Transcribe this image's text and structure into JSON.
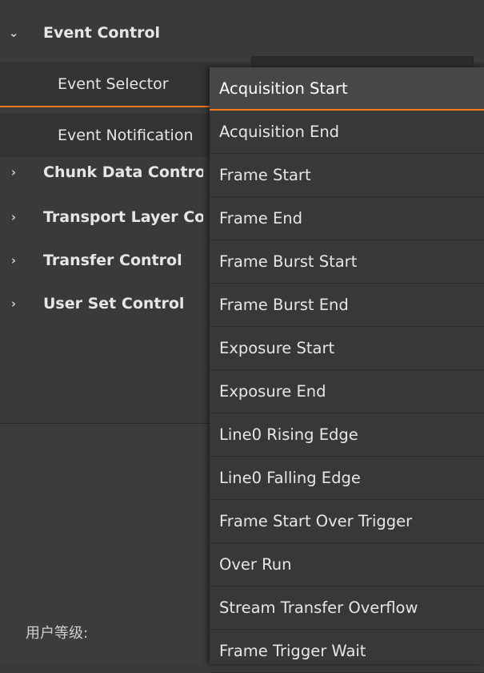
{
  "tree": {
    "event_control": {
      "arrow": "⌄",
      "label": "Event Control"
    },
    "event_selector": {
      "label": "Event Selector"
    },
    "event_notification": {
      "label": "Event Notification"
    },
    "chunk_data": {
      "arrow": "›",
      "label": "Chunk Data Control"
    },
    "transport_layer": {
      "arrow": "›",
      "label": "Transport Layer Control"
    },
    "transfer_control": {
      "arrow": "›",
      "label": "Transfer Control"
    },
    "user_set_control": {
      "arrow": "›",
      "label": "User Set Control"
    }
  },
  "footer": {
    "user_level_label": "用户等级:"
  },
  "dropdown": {
    "items": [
      "Acquisition Start",
      "Acquisition End",
      "Frame Start",
      "Frame End",
      "Frame Burst Start",
      "Frame Burst End",
      "Exposure Start",
      "Exposure End",
      "Line0 Rising Edge",
      "Line0 Falling Edge",
      "Frame Start Over Trigger",
      "Over Run",
      "Stream Transfer Overflow",
      "Frame Trigger Wait"
    ],
    "selected_index": 0
  },
  "colors": {
    "accent": "#ff7a1a",
    "background": "#3a3a3a",
    "dropdown_bg": "#383838"
  }
}
